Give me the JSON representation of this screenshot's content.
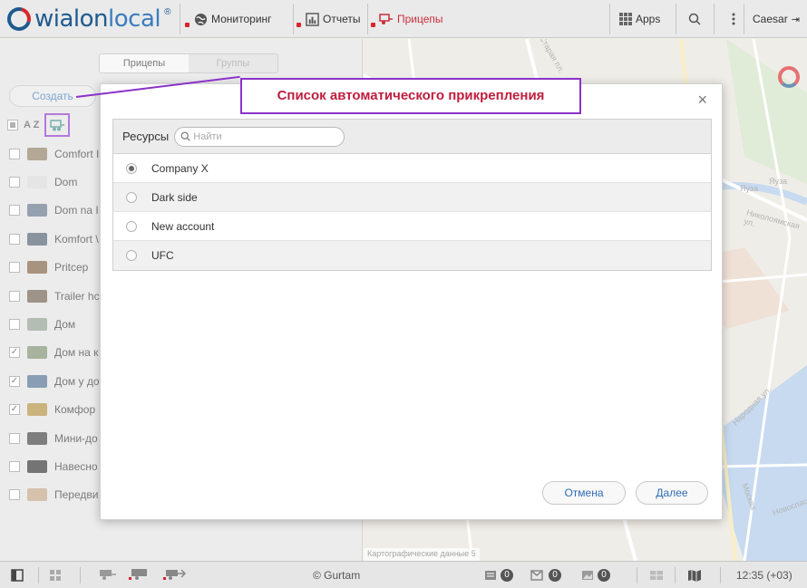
{
  "topbar": {
    "logo_text": "wialon",
    "logo_text_b": "local",
    "nav": [
      {
        "label": "Мониторинг",
        "icon": "globe-icon"
      },
      {
        "label": "Отчеты",
        "icon": "report-icon"
      },
      {
        "label": "Прицепы",
        "icon": "trailer-icon"
      }
    ],
    "apps_label": "Apps",
    "user_label": "Caesar"
  },
  "left_panel": {
    "tabs": [
      "Прицепы",
      "Группы"
    ],
    "create_label": "Создать",
    "sort_label": "A Z",
    "items": [
      {
        "label": "Comfort I",
        "checked": false,
        "color": "#8b7a5c"
      },
      {
        "label": "Dom",
        "checked": false,
        "color": "#d8d8d8"
      },
      {
        "label": "Dom na I",
        "checked": false,
        "color": "#5c6f83"
      },
      {
        "label": "Komfort \\",
        "checked": false,
        "color": "#4a5a6a"
      },
      {
        "label": "Pritcep",
        "checked": false,
        "color": "#7a5a3c"
      },
      {
        "label": "Trailer hc",
        "checked": false,
        "color": "#6a5a4a"
      },
      {
        "label": "Дом",
        "checked": false,
        "color": "#8a9a8a"
      },
      {
        "label": "Дом на к",
        "checked": true,
        "color": "#7a8a6a"
      },
      {
        "label": "Дом у до",
        "checked": true,
        "color": "#4a6a8a"
      },
      {
        "label": "Комфор",
        "checked": true,
        "color": "#b08a3a"
      },
      {
        "label": "Мини-до",
        "checked": false,
        "color": "#3a3a3a"
      },
      {
        "label": "Навесно",
        "checked": false,
        "color": "#2a2a2a"
      },
      {
        "label": "Передви",
        "checked": false,
        "color": "#c0a080"
      }
    ]
  },
  "map": {
    "labels": [
      "Старая пл.",
      "Яуза",
      "Яуза",
      "Николоямская ул.",
      "Народная ул.",
      "Москва",
      "Новоспасск"
    ],
    "copyright": "Картографические данные 5"
  },
  "modal": {
    "section_title": "Ресурсы",
    "search_placeholder": "Найти",
    "close_symbol": "×",
    "rows": [
      {
        "label": "Company X",
        "selected": true
      },
      {
        "label": "Dark side",
        "selected": false
      },
      {
        "label": "New account",
        "selected": false
      },
      {
        "label": "UFC",
        "selected": false
      }
    ],
    "cancel_label": "Отмена",
    "next_label": "Далее"
  },
  "annotation": {
    "text": "Список автоматического прикрепления"
  },
  "statusbar": {
    "copyright": "© Gurtam",
    "badge_counts": [
      "0",
      "0",
      "0"
    ],
    "time": "12:35 (+03)"
  },
  "colors": {
    "accent_red": "#c82f3c",
    "link_blue": "#2f6db3",
    "annotation_purple": "#8a32c9"
  }
}
